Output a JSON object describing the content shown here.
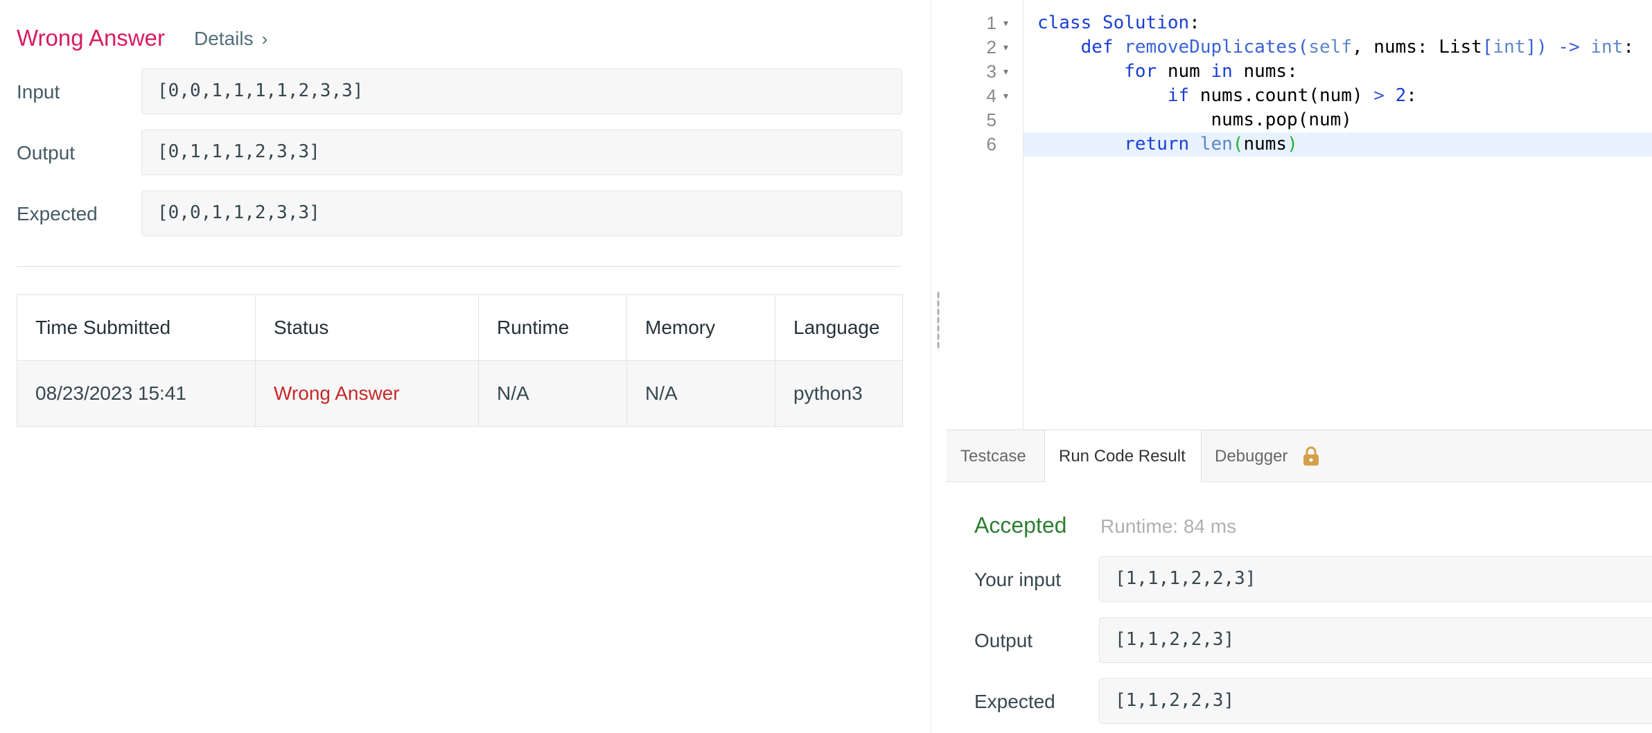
{
  "result": {
    "status": "Wrong Answer",
    "details_label": "Details",
    "details_chevron": "›",
    "rows": [
      {
        "label": "Input",
        "value": "[0,0,1,1,1,1,2,3,3]"
      },
      {
        "label": "Output",
        "value": "[0,1,1,1,2,3,3]"
      },
      {
        "label": "Expected",
        "value": "[0,0,1,1,2,3,3]"
      }
    ]
  },
  "submissions": {
    "headers": [
      "Time Submitted",
      "Status",
      "Runtime",
      "Memory",
      "Language"
    ],
    "rows": [
      {
        "time": "08/23/2023 15:41",
        "status": "Wrong Answer",
        "runtime": "N/A",
        "memory": "N/A",
        "language": "python3"
      }
    ]
  },
  "editor": {
    "line_numbers": [
      "1",
      "2",
      "3",
      "4",
      "5",
      "6"
    ],
    "fold_marker": "▾",
    "code_lines": [
      "class Solution:",
      "    def removeDuplicates(self, nums: List[int]) -> int:",
      "        for num in nums:",
      "            if nums.count(num) > 2:",
      "                nums.pop(num)",
      "        return len(nums)"
    ],
    "active_line": 6
  },
  "tabs": [
    {
      "label": "Testcase"
    },
    {
      "label": "Run Code Result",
      "active": true
    },
    {
      "label": "Debugger",
      "icon": "lock-icon"
    }
  ],
  "run_result": {
    "status": "Accepted",
    "runtime": "Runtime: 84 ms",
    "rows": [
      {
        "label": "Your input",
        "value": "[1,1,1,2,2,3]"
      },
      {
        "label": "Output",
        "value": "[1,1,2,2,3]"
      },
      {
        "label": "Expected",
        "value": "[1,1,2,2,3]"
      }
    ]
  },
  "colors": {
    "wrong_answer": "#d81b60",
    "status_wrong": "#c62828",
    "accepted": "#2e7d32",
    "active_line": "#e8f2ff",
    "lock": "#d4a04a"
  }
}
